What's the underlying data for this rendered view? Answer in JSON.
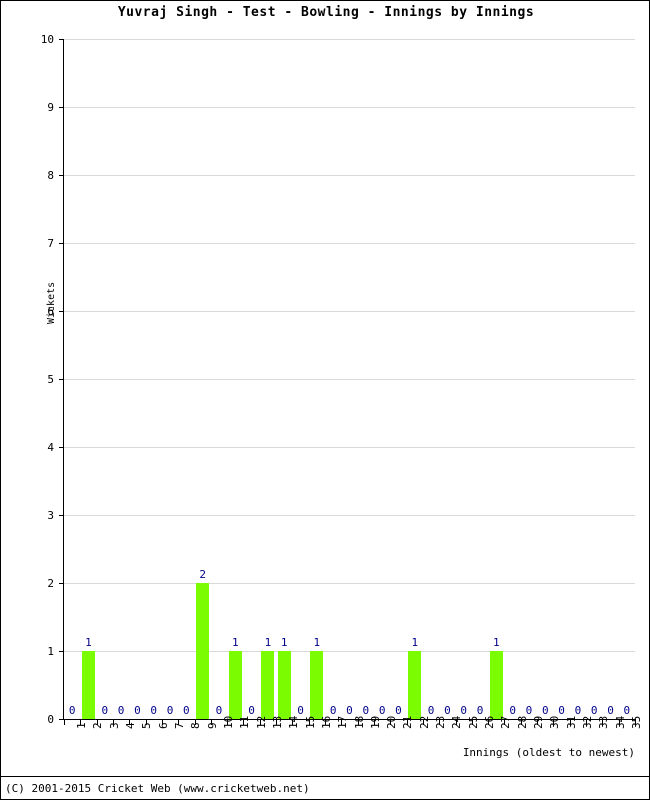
{
  "chart_data": {
    "type": "bar",
    "title": "Yuvraj Singh - Test - Bowling - Innings by Innings",
    "xlabel": "Innings (oldest to newest)",
    "ylabel": "Wickets",
    "ylim": [
      0,
      10
    ],
    "ytick_labels": [
      "0",
      "1",
      "2",
      "3",
      "4",
      "5",
      "6",
      "7",
      "8",
      "9",
      "10"
    ],
    "yticks": [
      0,
      1,
      2,
      3,
      4,
      5,
      6,
      7,
      8,
      9,
      10
    ],
    "grid": true,
    "legend": null,
    "bar_color": "#7CFC00",
    "value_label_color": "#00008B",
    "gridline_color": "#D9D9D9",
    "categories": [
      "1",
      "2",
      "3",
      "4",
      "5",
      "6",
      "7",
      "8",
      "9",
      "10",
      "11",
      "12",
      "13",
      "14",
      "15",
      "16",
      "17",
      "18",
      "19",
      "20",
      "21",
      "22",
      "23",
      "24",
      "25",
      "26",
      "27",
      "28",
      "29",
      "30",
      "31",
      "32",
      "33",
      "34",
      "35"
    ],
    "values": [
      0,
      1,
      0,
      0,
      0,
      0,
      0,
      0,
      2,
      0,
      1,
      0,
      1,
      1,
      0,
      1,
      0,
      0,
      0,
      0,
      0,
      1,
      0,
      0,
      0,
      0,
      1,
      0,
      0,
      0,
      0,
      0,
      0,
      0,
      0
    ],
    "value_labels": [
      "0",
      "1",
      "0",
      "0",
      "0",
      "0",
      "0",
      "0",
      "2",
      "0",
      "1",
      "0",
      "1",
      "1",
      "0",
      "1",
      "0",
      "0",
      "0",
      "0",
      "0",
      "1",
      "0",
      "0",
      "0",
      "0",
      "1",
      "0",
      "0",
      "0",
      "0",
      "0",
      "0",
      "0",
      "0"
    ],
    "series": [
      {
        "name": "Wickets",
        "values": [
          0,
          1,
          0,
          0,
          0,
          0,
          0,
          0,
          2,
          0,
          1,
          0,
          1,
          1,
          0,
          1,
          0,
          0,
          0,
          0,
          0,
          1,
          0,
          0,
          0,
          0,
          1,
          0,
          0,
          0,
          0,
          0,
          0,
          0,
          0
        ]
      }
    ]
  },
  "footer": {
    "copyright": "(C) 2001-2015 Cricket Web (www.cricketweb.net)"
  }
}
